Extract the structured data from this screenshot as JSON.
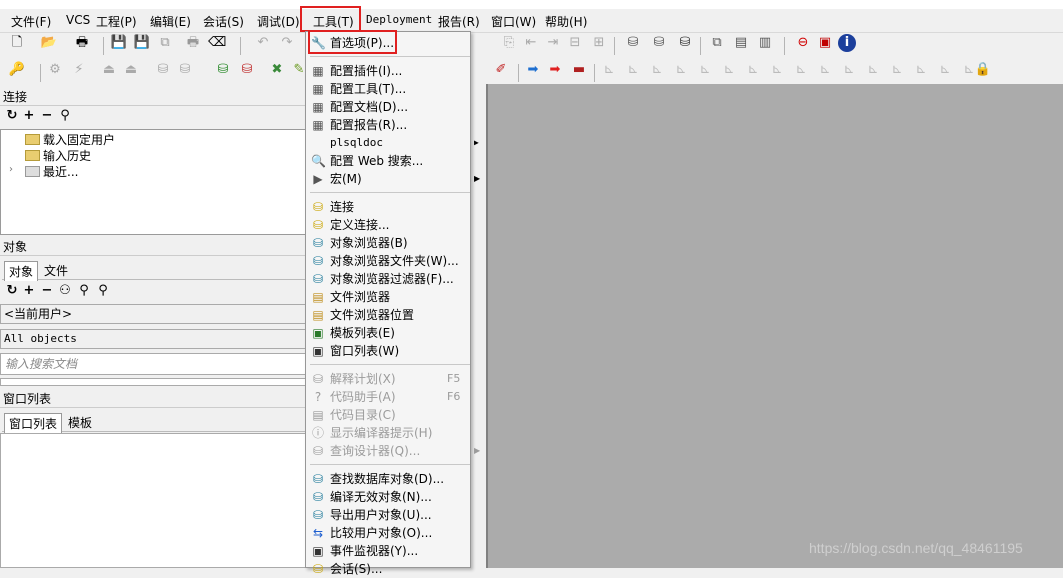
{
  "menubar": {
    "items": [
      "文件(F)",
      "VCS",
      "工程(P)",
      "编辑(E)",
      "会话(S)",
      "调试(D)",
      "工具(T)",
      "Deployment",
      "报告(R)",
      "窗口(W)",
      "帮助(H)"
    ]
  },
  "panels": {
    "connection": {
      "title": "连接",
      "nodes": [
        "载入固定用户",
        "输入历史",
        "最近..."
      ]
    },
    "objects": {
      "title": "对象",
      "tabs": [
        "对象",
        "文件"
      ],
      "user_select": "<当前用户>",
      "filter_select": "All objects",
      "search_placeholder": "输入搜索文档"
    },
    "window_list": {
      "title": "窗口列表",
      "tabs": [
        "窗口列表",
        "模板"
      ]
    }
  },
  "tools_menu": {
    "group1": [
      {
        "label": "首选项(P)...",
        "icon": "wrench-icon"
      }
    ],
    "group2": [
      {
        "label": "配置插件(I)...",
        "icon": "plugin-config-icon"
      },
      {
        "label": "配置工具(T)...",
        "icon": "tool-config-icon"
      },
      {
        "label": "配置文档(D)...",
        "icon": "doc-config-icon"
      },
      {
        "label": "配置报告(R)...",
        "icon": "report-config-icon"
      },
      {
        "label": "plsqldoc",
        "icon": "",
        "submenu": true
      },
      {
        "label": "配置 Web 搜索...",
        "icon": "web-search-icon"
      },
      {
        "label": "宏(M)",
        "icon": "macro-icon",
        "submenu": true
      }
    ],
    "group3": [
      {
        "label": "连接",
        "icon": "connection-icon"
      },
      {
        "label": "定义连接...",
        "icon": "define-connection-icon"
      },
      {
        "label": "对象浏览器(B)",
        "icon": "object-browser-icon"
      },
      {
        "label": "对象浏览器文件夹(W)...",
        "icon": "object-browser-folder-icon"
      },
      {
        "label": "对象浏览器过滤器(F)...",
        "icon": "object-browser-filter-icon"
      },
      {
        "label": "文件浏览器",
        "icon": "file-browser-icon"
      },
      {
        "label": "文件浏览器位置",
        "icon": "file-browser-location-icon"
      },
      {
        "label": "模板列表(E)",
        "icon": "template-list-icon"
      },
      {
        "label": "窗口列表(W)",
        "icon": "window-list-icon"
      }
    ],
    "group4": [
      {
        "label": "解释计划(X)",
        "icon": "explain-plan-icon",
        "shortcut": "F5",
        "disabled": true
      },
      {
        "label": "代码助手(A)",
        "icon": "code-assistant-icon",
        "shortcut": "F6",
        "disabled": true
      },
      {
        "label": "代码目录(C)",
        "icon": "code-contents-icon",
        "disabled": true
      },
      {
        "label": "显示编译器提示(H)",
        "icon": "compiler-hints-icon",
        "disabled": true
      },
      {
        "label": "查询设计器(Q)...",
        "icon": "query-designer-icon",
        "disabled": true,
        "submenu": true
      }
    ],
    "group5": [
      {
        "label": "查找数据库对象(D)...",
        "icon": "find-db-objects-icon"
      },
      {
        "label": "编译无效对象(N)...",
        "icon": "compile-invalid-icon"
      },
      {
        "label": "导出用户对象(U)...",
        "icon": "export-user-objects-icon"
      },
      {
        "label": "比较用户对象(O)...",
        "icon": "compare-user-objects-icon"
      },
      {
        "label": "事件监视器(Y)...",
        "icon": "event-monitor-icon"
      },
      {
        "label": "会话(S)...",
        "icon": "session-icon"
      }
    ]
  },
  "watermark": "https://blog.csdn.net/qq_48461195"
}
